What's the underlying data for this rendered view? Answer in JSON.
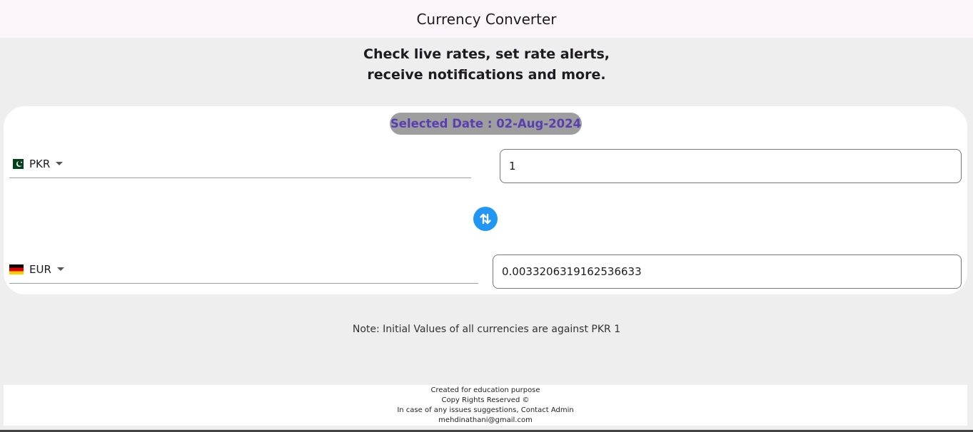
{
  "appbar": {
    "title": "Currency Converter"
  },
  "tagline": {
    "line1": "Check live rates, set rate alerts,",
    "line2": "receive notifications and more."
  },
  "converter": {
    "selected_date": "Selected Date : 02-Aug-2024",
    "from": {
      "code": "PKR",
      "flag_icon": "pakistan-flag-icon",
      "amount": "1"
    },
    "to": {
      "code": "EUR",
      "flag_icon": "germany-flag-icon",
      "amount": "0.0033206319162536633"
    },
    "swap_icon": "swap-vertical-icon"
  },
  "note": "Note: Initial Values of all currencies are against PKR 1",
  "footer": {
    "line1": "Created for education purpose",
    "line2": "Copy Rights Reserved ©",
    "line3": "In case of any issues suggestions, Contact Admin",
    "line4": "mehdinathani@gmail.com"
  },
  "colors": {
    "appbar_bg": "#fdf5fc",
    "page_bg": "#eeeeee",
    "chip_bg": "#9e9e9e",
    "chip_text": "#5b3fb0",
    "swap_button": "#2196f3"
  }
}
